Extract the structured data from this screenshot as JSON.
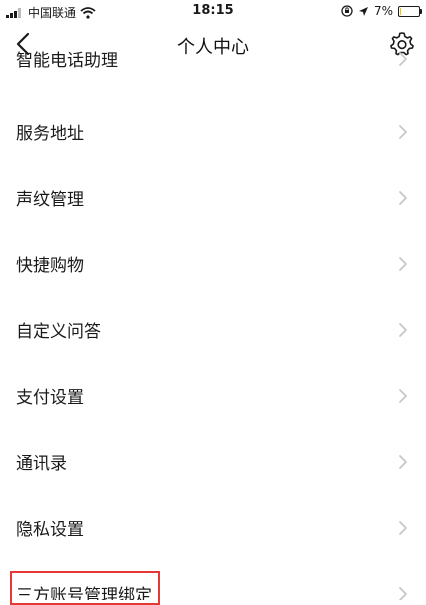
{
  "status_bar": {
    "carrier": "中国联通",
    "time": "18:15",
    "battery_percent": "7%",
    "battery_level": 0.07
  },
  "nav": {
    "title": "个人中心"
  },
  "menu_items": [
    {
      "label": "智能电话助理"
    },
    {
      "label": "服务地址"
    },
    {
      "label": "声纹管理"
    },
    {
      "label": "快捷购物"
    },
    {
      "label": "自定义问答"
    },
    {
      "label": "支付设置"
    },
    {
      "label": "通讯录"
    },
    {
      "label": "隐私设置"
    },
    {
      "label": "三方账号管理绑定"
    }
  ],
  "colors": {
    "highlight": "#e53935",
    "battery_fill": "#f5c400",
    "chevron": "#c7c7cc"
  }
}
